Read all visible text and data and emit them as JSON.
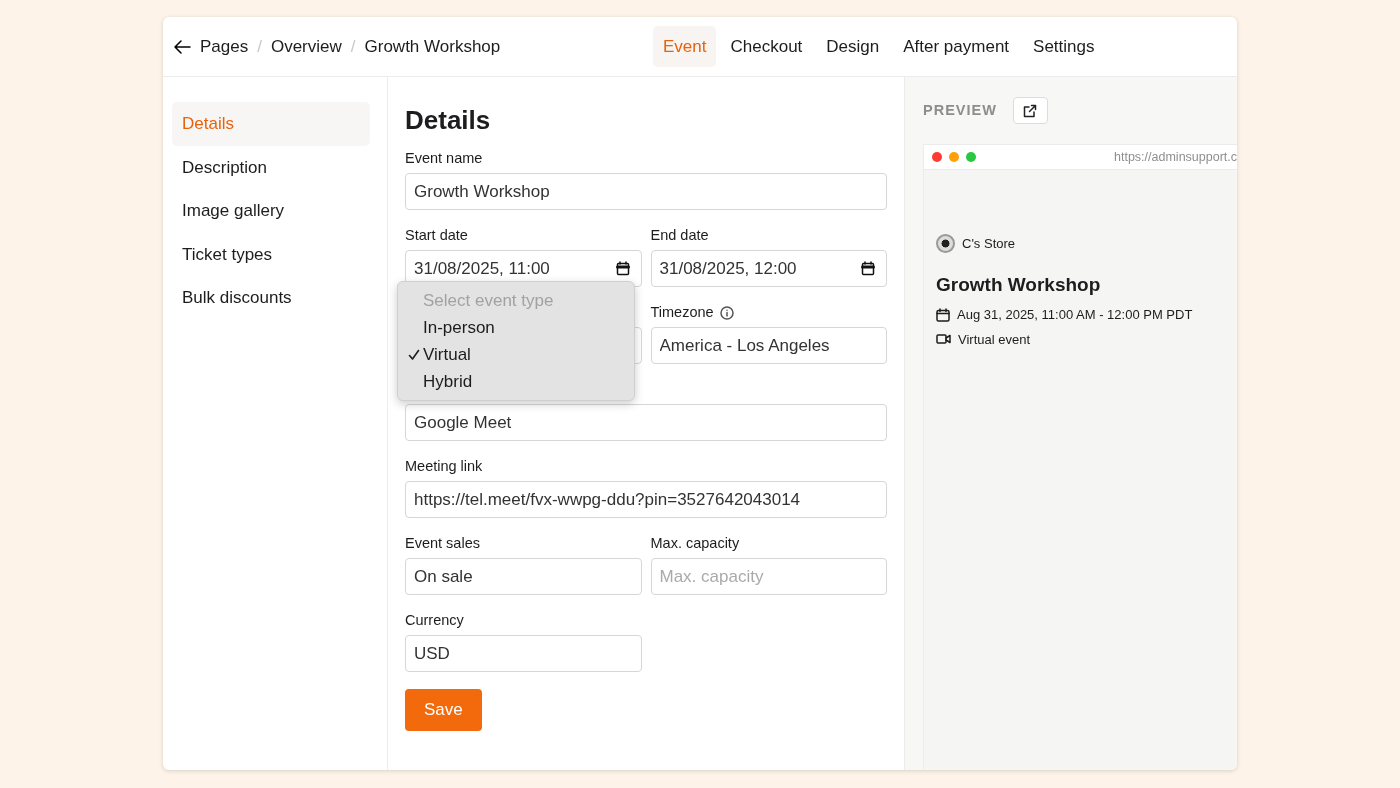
{
  "breadcrumb": [
    {
      "label": "Pages"
    },
    {
      "separator": "/",
      "label": "Overview"
    },
    {
      "separator": "/",
      "label": "Growth Workshop"
    }
  ],
  "tabs": [
    {
      "label": "Event",
      "selected": true
    },
    {
      "label": "Checkout",
      "selected": false
    },
    {
      "label": "Design",
      "selected": false
    },
    {
      "label": "After payment",
      "selected": false
    },
    {
      "label": "Settings",
      "selected": false
    }
  ],
  "sidebar": {
    "items": [
      {
        "label": "Details",
        "selected": true
      },
      {
        "label": "Description",
        "selected": false
      },
      {
        "label": "Image gallery",
        "selected": false
      },
      {
        "label": "Ticket types",
        "selected": false
      },
      {
        "label": "Bulk discounts",
        "selected": false
      }
    ]
  },
  "form": {
    "title": "Details",
    "rows": [
      [
        {
          "kind": "text",
          "label": "Event name",
          "value": "Growth Workshop"
        }
      ],
      [
        {
          "kind": "date",
          "label": "Start date",
          "value": "31/08/2025, 11:00"
        },
        {
          "kind": "date",
          "label": "End date",
          "value": "31/08/2025, 12:00"
        }
      ],
      [
        {
          "kind": "select",
          "menu": true
        },
        {
          "kind": "select",
          "label": "Timezone",
          "info": true,
          "value": "America - Los Angeles"
        }
      ],
      [
        {
          "kind": "select",
          "value": "Google Meet"
        }
      ],
      [
        {
          "kind": "text",
          "label": "Meeting link",
          "value": "https://tel.meet/fvx-wwpg-ddu?pin=3527642043014"
        }
      ],
      [
        {
          "kind": "select",
          "label": "Event sales",
          "value": "On sale"
        },
        {
          "kind": "text",
          "label": "Max. capacity",
          "placeholder": "Max. capacity"
        }
      ],
      [
        {
          "kind": "select",
          "label": "Currency",
          "value": "USD",
          "half": true
        }
      ]
    ],
    "save_button": "Save"
  },
  "dropdown": {
    "placeholder": "Select event type",
    "options": [
      {
        "label": "In-person",
        "selected": false
      },
      {
        "label": "Virtual",
        "selected": true
      },
      {
        "label": "Hybrid",
        "selected": false
      }
    ]
  },
  "preview": {
    "label": "PREVIEW",
    "url": "https://adminsupport.c",
    "store": "C's Store",
    "title": "Growth Workshop",
    "date": "Aug 31, 2025, 11:00 AM - 12:00 PM PDT",
    "location": "Virtual event"
  }
}
